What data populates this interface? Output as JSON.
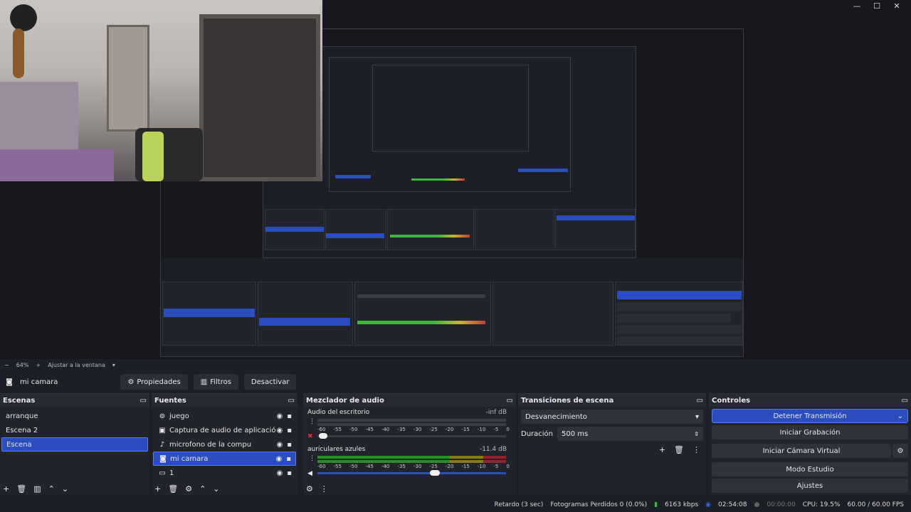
{
  "zoom": {
    "level": "64%",
    "fit_label": "Ajustar a la ventana"
  },
  "toolbar": {
    "source_name": "mi camara",
    "properties": "Propiedades",
    "filters": "Filtros",
    "deactivate": "Desactivar"
  },
  "scenes": {
    "title": "Escenas",
    "items": [
      "arranque",
      "Escena 2",
      "Escena"
    ],
    "selected": 2
  },
  "sources": {
    "title": "Fuentes",
    "items": [
      {
        "label": "juego",
        "icon": "gamepad-icon"
      },
      {
        "label": "Captura de audio de aplicación (BET",
        "icon": "app-audio-icon"
      },
      {
        "label": "microfono de la compu",
        "icon": "microphone-icon"
      },
      {
        "label": "mi camara",
        "icon": "camera-icon"
      },
      {
        "label": "1",
        "icon": "display-icon"
      }
    ],
    "selected": 3
  },
  "mixer": {
    "title": "Mezclador de audio",
    "channels": [
      {
        "name": "Audio del escritorio",
        "db": "-inf dB",
        "muted": true
      },
      {
        "name": "auriculares azules",
        "db": "-11.4 dB",
        "muted": false
      }
    ],
    "ticks": [
      "-60",
      "-55",
      "-50",
      "-45",
      "-40",
      "-35",
      "-30",
      "-25",
      "-20",
      "-15",
      "-10",
      "-5",
      "0"
    ]
  },
  "transitions": {
    "title": "Transiciones de escena",
    "type": "Desvanecimiento",
    "duration_label": "Duración",
    "duration": "500 ms"
  },
  "controls": {
    "title": "Controles",
    "buttons": [
      "Detener Transmisión",
      "Iniciar Grabación",
      "Iniciar Cámara Virtual",
      "Modo Estudio",
      "Ajustes"
    ]
  },
  "status": {
    "delay": "Retardo (3 sec)",
    "dropped": "Fotogramas Perdidos 0 (0.0%)",
    "bitrate": "6163 kbps",
    "live_time": "02:54:08",
    "rec_time": "00:00:00",
    "cpu": "CPU: 19.5%",
    "fps": "60.00 / 60.00 FPS"
  },
  "colors": {
    "accent": "#2c4dbe",
    "meter_green": "#3cb83c",
    "meter_yellow": "#c8b82a",
    "meter_red": "#c83a3a"
  }
}
